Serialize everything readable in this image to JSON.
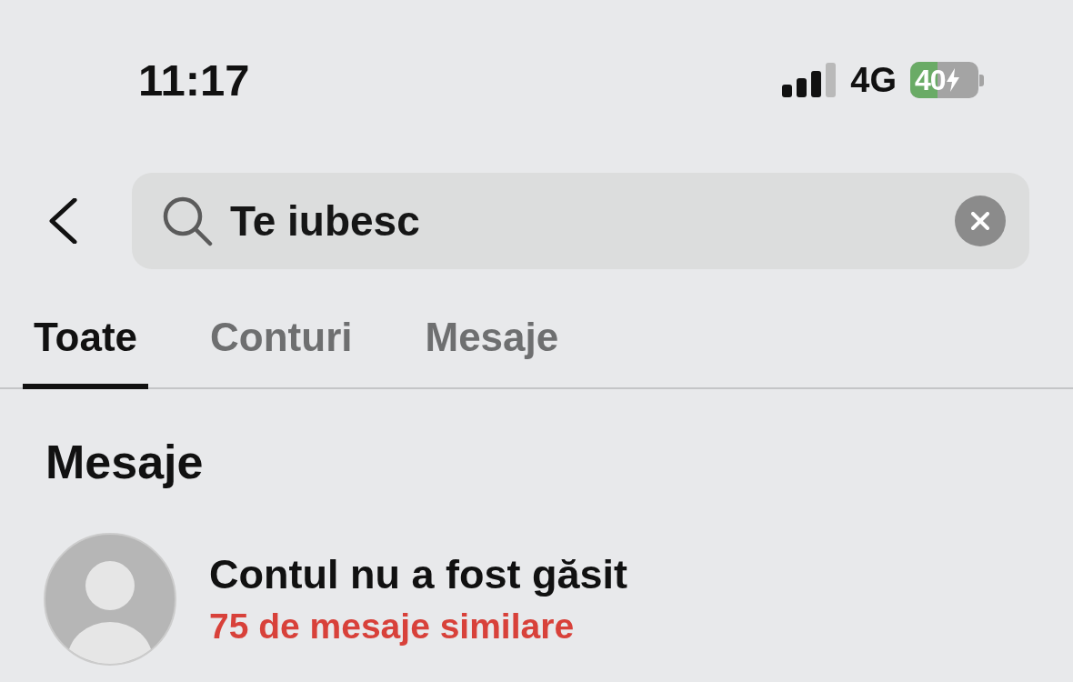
{
  "status_bar": {
    "time": "11:17",
    "network": "4G",
    "battery": "40",
    "charging": true
  },
  "search": {
    "value": "Te iubesc"
  },
  "tabs": [
    {
      "label": "Toate",
      "selected": true
    },
    {
      "label": "Conturi",
      "selected": false
    },
    {
      "label": "Mesaje",
      "selected": false
    }
  ],
  "sections": [
    {
      "title": "Mesaje",
      "items": [
        {
          "title": "Contul nu a fost găsit",
          "subtitle": "75 de mesaje similare"
        }
      ]
    }
  ]
}
